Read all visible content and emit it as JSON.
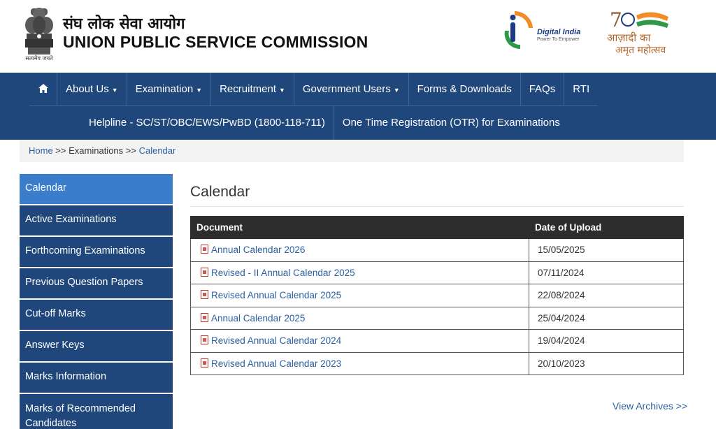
{
  "header": {
    "org_hindi": "संघ लोक सेवा आयोग",
    "org_english": "UNION PUBLIC SERVICE COMMISSION",
    "emblem_motto": "सत्यमेव जयते",
    "digital_india_name": "Digital India",
    "digital_india_tagline": "Power To Empower",
    "azadi_line1": "आज़ादी का",
    "azadi_line2": "अमृत महोत्सव"
  },
  "nav": {
    "home_icon": "home-icon",
    "row1": [
      "About Us",
      "Examination",
      "Recruitment",
      "Government Users",
      "Forms & Downloads",
      "FAQs",
      "RTI"
    ],
    "row2": [
      "Helpline - SC/ST/OBC/EWS/PwBD (1800-118-711)",
      "One Time Registration (OTR) for Examinations"
    ]
  },
  "breadcrumb": {
    "home": "Home",
    "sep1": " >> ",
    "middle": "Examinations",
    "sep2": " >> ",
    "current": "Calendar"
  },
  "sidebar": {
    "items": [
      "Calendar",
      "Active Examinations",
      "Forthcoming Examinations",
      "Previous Question Papers",
      "Cut-off Marks",
      "Answer Keys",
      "Marks Information",
      "Marks of Recommended Candidates"
    ]
  },
  "main": {
    "title": "Calendar",
    "table": {
      "headers": [
        "Document",
        "Date of Upload"
      ],
      "rows": [
        {
          "doc": "Annual Calendar 2026",
          "date": "15/05/2025"
        },
        {
          "doc": "Revised - II Annual Calendar 2025",
          "date": "07/11/2024"
        },
        {
          "doc": "Revised Annual Calendar 2025",
          "date": "22/08/2024"
        },
        {
          "doc": "Annual Calendar 2025",
          "date": "25/04/2024"
        },
        {
          "doc": "Revised Annual Calendar 2024",
          "date": "19/04/2024"
        },
        {
          "doc": "Revised Annual Calendar 2023",
          "date": "20/10/2023"
        }
      ]
    },
    "view_archives": "View Archives >>"
  },
  "colors": {
    "nav_blue": "#1f477b",
    "active_blue": "#3a7ecb",
    "link_blue": "#2a5fa0",
    "table_header": "#2d2d2d"
  }
}
